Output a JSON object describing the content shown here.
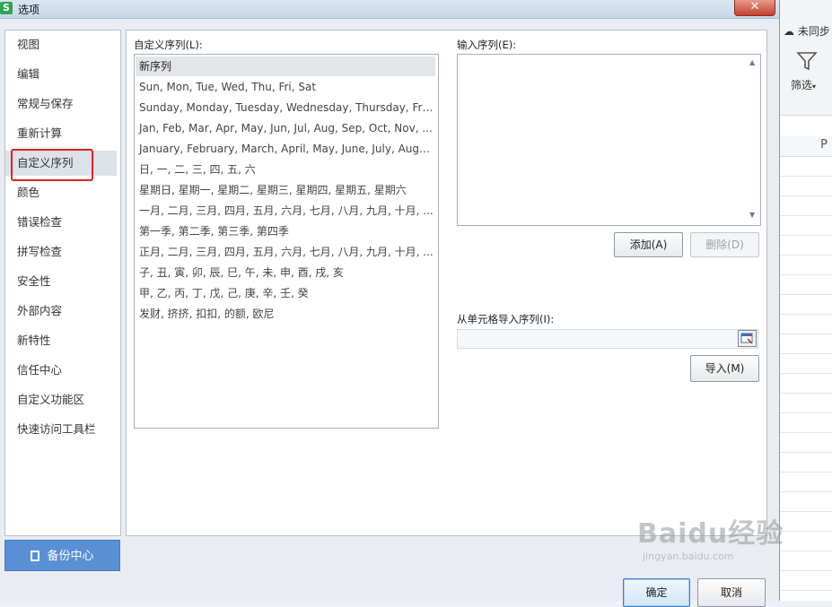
{
  "dialog": {
    "title": "选项",
    "app_icon_letter": "S",
    "close_symbol": "✕"
  },
  "nav": {
    "items": [
      {
        "label": "视图"
      },
      {
        "label": "编辑"
      },
      {
        "label": "常规与保存"
      },
      {
        "label": "重新计算"
      },
      {
        "label": "自定义序列",
        "selected": true
      },
      {
        "label": "颜色"
      },
      {
        "label": "错误检查"
      },
      {
        "label": "拼写检查"
      },
      {
        "label": "安全性"
      },
      {
        "label": "外部内容"
      },
      {
        "label": "新特性"
      },
      {
        "label": "信任中心"
      },
      {
        "label": "自定义功能区"
      },
      {
        "label": "快速访问工具栏"
      }
    ],
    "backup_label": "备份中心"
  },
  "custom_lists": {
    "label": "自定义序列(L):",
    "items": [
      "新序列",
      "Sun, Mon, Tue, Wed, Thu, Fri, Sat",
      "Sunday, Monday, Tuesday, Wednesday, Thursday, Frid...",
      "Jan, Feb, Mar, Apr, May, Jun, Jul, Aug, Sep, Oct, Nov, ...",
      "January, February, March, April, May, June, July, Augus...",
      "日, 一, 二, 三, 四, 五, 六",
      "星期日, 星期一, 星期二, 星期三, 星期四, 星期五, 星期六",
      "一月, 二月, 三月, 四月, 五月, 六月, 七月, 八月, 九月, 十月, ...",
      "第一季, 第二季, 第三季, 第四季",
      "正月, 二月, 三月, 四月, 五月, 六月, 七月, 八月, 九月, 十月, ...",
      "子, 丑, 寅, 卯, 辰, 巳, 午, 未, 申, 酉, 戌, 亥",
      "甲, 乙, 丙, 丁, 戊, 己, 庚, 辛, 壬, 癸",
      "发财, 挤挤, 扣扣, 的额, 欧尼"
    ],
    "selected_index": 0
  },
  "input_list": {
    "label": "输入序列(E):",
    "value": "",
    "add_label": "添加(A)",
    "delete_label": "删除(D)"
  },
  "import": {
    "label": "从单元格导入序列(I):",
    "value": "",
    "button_label": "导入(M)"
  },
  "footer": {
    "ok_label": "确定",
    "cancel_label": "取消"
  },
  "background_app": {
    "sync_label": "未同步",
    "filter_label": "筛选",
    "column_letter": "P"
  },
  "watermark": {
    "brand": "Baidu经验",
    "url": "jingyan.baidu.com"
  },
  "colors": {
    "highlight_border": "#e02020",
    "backup_button": "#5a8fd6",
    "close_button": "#c4422d"
  }
}
